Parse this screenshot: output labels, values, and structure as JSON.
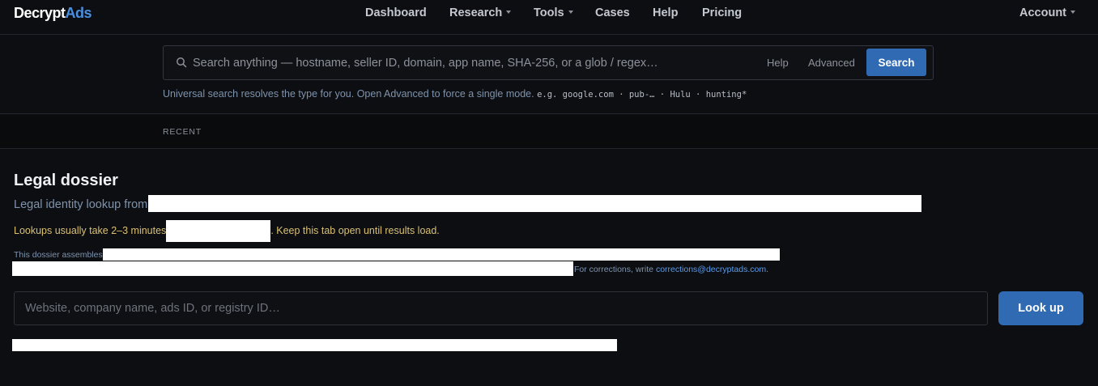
{
  "brand": {
    "part1": "Decrypt",
    "part2": "Ads"
  },
  "nav": {
    "dashboard": "Dashboard",
    "research": "Research",
    "tools": "Tools",
    "cases": "Cases",
    "help": "Help",
    "pricing": "Pricing",
    "account": "Account"
  },
  "search": {
    "placeholder": "Search anything — hostname, seller ID, domain, app name, SHA-256, or a glob / regex…",
    "help_label": "Help",
    "advanced_label": "Advanced",
    "button_label": "Search",
    "hint_text": "Universal search resolves the type for you. Open Advanced to force a single mode.",
    "hint_examples": "e.g. google.com · pub-… · Hulu · hunting*"
  },
  "recent": {
    "label": "RECENT"
  },
  "dossier": {
    "title": "Legal dossier",
    "subtitle_prefix": "Legal identity lookup from",
    "warning_prefix": "Lookups usually take 2–3 minutes",
    "warning_suffix": ". Keep this tab open until results load.",
    "assembles_prefix": "This dossier assembles",
    "corrections_prefix": "For corrections, write ",
    "corrections_email": "corrections@decryptads.com",
    "corrections_suffix": ".",
    "input_placeholder": "Website, company name, ads ID, or registry ID…",
    "lookup_label": "Look up"
  },
  "colors": {
    "background": "#0d0e11",
    "accent": "#2f6ab3",
    "brand_blue": "#4a90e2",
    "warning": "#d9c073",
    "link": "#5c9be6"
  }
}
